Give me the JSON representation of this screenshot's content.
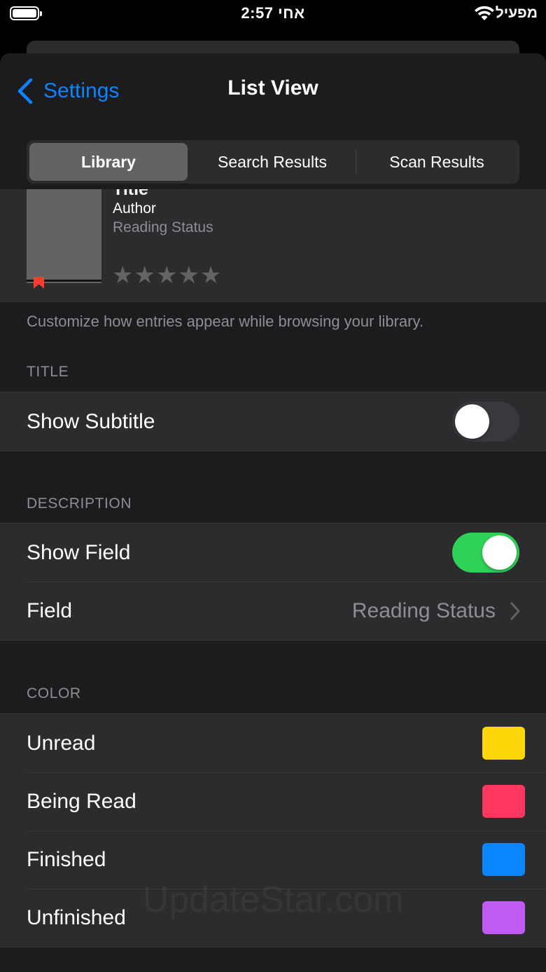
{
  "status_bar": {
    "time": "2:57 אחי",
    "carrier": "מפעיל",
    "icons": [
      "battery-icon",
      "wifi-icon"
    ]
  },
  "nav": {
    "back_label": "Settings",
    "title": "List View"
  },
  "segments": [
    {
      "label": "Library",
      "selected": true
    },
    {
      "label": "Search Results",
      "selected": false
    },
    {
      "label": "Scan Results",
      "selected": false
    }
  ],
  "preview": {
    "title": "Title",
    "author": "Author",
    "status": "Reading Status",
    "stars": "★★★★★",
    "rating_filled": 0,
    "rating_max": 5
  },
  "footnote": "Customize how entries appear while browsing your library.",
  "sections": {
    "title": {
      "header": "TITLE",
      "show_subtitle_label": "Show Subtitle",
      "show_subtitle_on": false
    },
    "description": {
      "header": "DESCRIPTION",
      "show_field_label": "Show Field",
      "show_field_on": true,
      "field_label": "Field",
      "field_value": "Reading Status"
    },
    "color": {
      "header": "COLOR",
      "items": [
        {
          "label": "Unread",
          "color": "#ffd60a"
        },
        {
          "label": "Being Read",
          "color": "#ff375f"
        },
        {
          "label": "Finished",
          "color": "#0a84ff"
        },
        {
          "label": "Unfinished",
          "color": "#bf5af2"
        }
      ]
    }
  },
  "colors": {
    "accent": "#0a84ff",
    "toggle_on": "#30d158",
    "background": "#1c1c1e",
    "cell": "#2c2c2e"
  },
  "watermark": "UpdateStar.com"
}
